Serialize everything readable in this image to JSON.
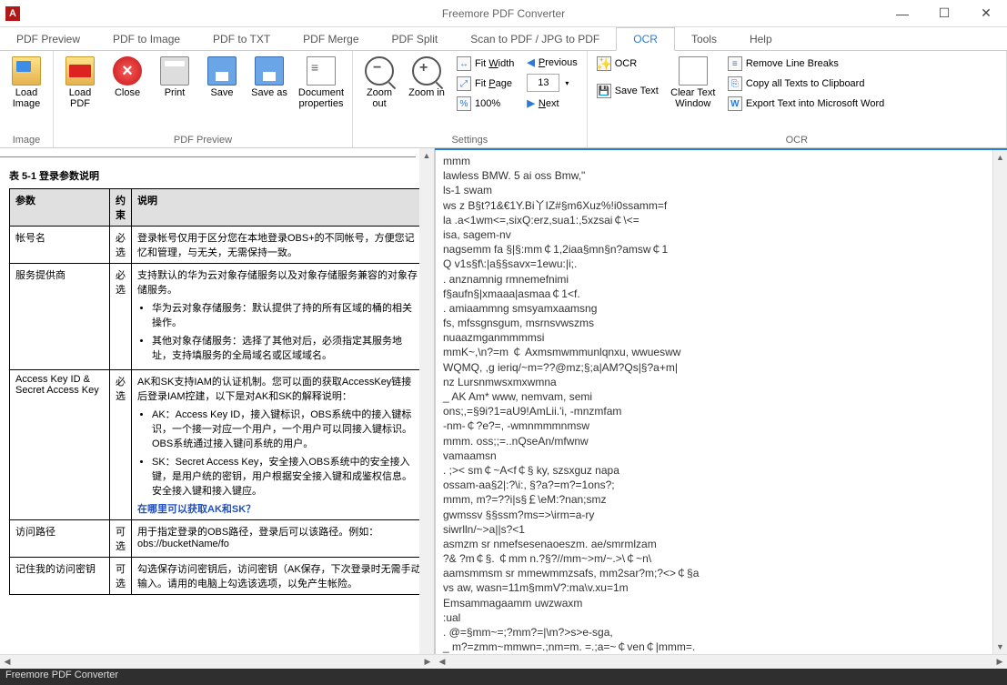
{
  "app": {
    "title": "Freemore PDF Converter",
    "status": "Freemore PDF Converter"
  },
  "menu": [
    {
      "label": "PDF Preview",
      "name": "pdf-preview"
    },
    {
      "label": "PDF to Image",
      "name": "pdf-to-image"
    },
    {
      "label": "PDF to TXT",
      "name": "pdf-to-txt"
    },
    {
      "label": "PDF Merge",
      "name": "pdf-merge"
    },
    {
      "label": "PDF Split",
      "name": "pdf-split"
    },
    {
      "label": "Scan to PDF / JPG to PDF",
      "name": "scan-to-pdf"
    },
    {
      "label": "OCR",
      "name": "ocr",
      "active": true
    },
    {
      "label": "Tools",
      "name": "tools"
    },
    {
      "label": "Help",
      "name": "help"
    }
  ],
  "ribbon": {
    "group_image": {
      "label": "Image",
      "load_image": "Load Image"
    },
    "group_pdf_preview": {
      "label": "PDF Preview",
      "load_pdf": "Load PDF",
      "close": "Close",
      "print": "Print",
      "save": "Save",
      "save_as": "Save as",
      "doc_props": "Document properties"
    },
    "group_settings": {
      "label": "Settings",
      "zoom_out": "Zoom out",
      "zoom_in": "Zoom in",
      "fit_width": "Fit Width",
      "fit_page": "Fit Page",
      "hundred": "100%",
      "previous": "Previous",
      "next": "Next",
      "page": "13"
    },
    "group_ocr": {
      "label": "OCR",
      "ocr": "OCR",
      "save_text": "Save Text",
      "clear_text": "Clear Text Window",
      "remove_breaks": "Remove Line Breaks",
      "copy_all": "Copy all Texts to Clipboard",
      "export_word": "Export Text into Microsoft Word"
    }
  },
  "pdf": {
    "table_title": "表 5-1 登录参数说明",
    "th_param": "参数",
    "th_req": "约束",
    "th_desc": "说明",
    "rows": [
      {
        "param": "帐号名",
        "req": "必选",
        "desc": "登录帐号仅用于区分您在本地登录OBS+的不同帐号，方便您记忆和管理，与无关，无需保持一致。"
      },
      {
        "param": "服务提供商",
        "req": "必选",
        "desc": "",
        "bullets": [
          "华为云对象存储服务：默认提供了持的所有区域的桶的相关操作。",
          "其他对象存储服务：选择了其他对后，必须指定其服务地址，支持填服务的全局域名或区域域名。"
        ],
        "preface": "支持默认的华为云对象存储服务以及对象存储服务兼容的对象存储服务。"
      },
      {
        "param": "Access Key ID & Secret Access Key",
        "req": "必选",
        "desc": "",
        "preface": "AK和SK支持IAM的认证机制。您可以面的获取AccessKey链接后登录IAM控建，以下是对AK和SK的解释说明：",
        "bullets": [
          "AK：Access Key ID，接入键标识，OBS系统中的接入键标识，一个接一对应一个用户，一个用户可以同接入键标识。OBS系统通过接入键问系统的用户。",
          "SK：Secret Access Key，安全接入OBS系统中的安全接入键，是用户统的密钥，用户根据安全接入键和成鉴权信息。安全接入键和接入键应。"
        ],
        "link": "在哪里可以获取AK和SK？"
      },
      {
        "param": "访问路径",
        "req": "可选",
        "desc": "用于指定登录的OBS路径，登录后可以该路径。例如：obs://bucketName/fo"
      },
      {
        "param": "记住我的访问密钥",
        "req": "可选",
        "desc": "勾选保存访问密钥后，访问密钥（AK保存，下次登录时无需手动输入。请用的电脑上勾选该选项，以免产生帐险。"
      }
    ]
  },
  "ocr_text": "mmm\nlawless BMW. 5 ai oss Bmw,\"\nls-1 swam\nws z B§t?1&€1Y.Bi丫IZ#§m6Xuz%!i0ssamm=f\nla .a<1wm<=,sixQ:erz,sua1:,5xzsai￠\\<=\nisa, sagem-nv\nnagsemm fa §|§:mm￠1,2iaa§mn§n?amsw￠1\nQ v1s§f\\:|a§§savx=1ewu:|i;.\n. anznamnig rmnemefnimi\nf§aufn§|xmaaa|asmaa￠1<f.\n. amiaammng smsyamxaamsng\nfs, mfssgnsgum, msrnsvwszms\nnuaazmganmmmmsi\nmmK~,\\n?=m ￠ Axmsmwmmunlqnxu, wwuesww\nWQMQ, ,g ieriq/~m=??@mz;§;a|AM?Qs|§?a+m|\nnz Lursnmwsxmxwmna\n_ AK Am* www, nemvam, semi\nons;,=§9i?1=aU9!AmLii.'i, -mnzmfam\n-nm-￠?e?=, -wmnmmmnmsw\nmmm. oss;;=..nQseAn/mfwnw\nvamaamsn\n. ;>< sm￠~A<f￠§ ky, szsxguz napa\nossam-aa§2|:?\\i:, §?a?=m?=1ons?;\nmmm, m?=??i|s§￡\\eM:?nan;smz\ngwmssv §§ssm?ms=>\\irm=a-ry\nsiwrlln/~>a||s?<1\nasmzm sr nmefsesenaoeszm. ae/smrmlzam\n?& ?m￠§. ￠mm n.?§?//mm~>m/~.>\\￠~n\\\naamsmmsm sr mmewmmzsafs, mm2sar?m;?<>￠§a\nvs aw, wasn=11m§mmV?:ma\\v.xu=1m\nEmsammagaamm uwzwaxm\n:ual\n. @=§mm~=;?mm?=|\\m?>s>e-sga,\n_ m?=zmm~mmwn=.;nm=m. =.;a=~￠ven￠|mmm=."
}
